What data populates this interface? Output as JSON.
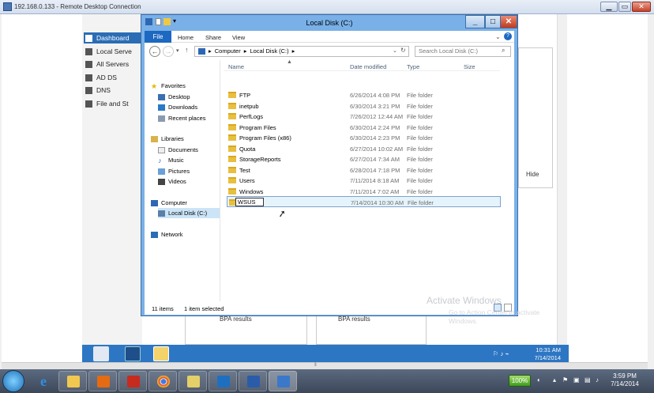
{
  "rdp": {
    "title": "192.168.0.133 - Remote Desktop Connection",
    "minimize": "▁",
    "restore": "▭",
    "close": "✕"
  },
  "server_manager": {
    "nav": [
      "Dashboard",
      "Local Server",
      "All Servers",
      "AD DS",
      "DNS",
      "File and Storage Services"
    ],
    "nav_visible": [
      "Dashboard",
      "Local Serve",
      "All Servers",
      "AD DS",
      "DNS",
      "File and St"
    ],
    "hide_label": "Hide",
    "bpa1": "BPA results",
    "bpa2": "BPA results",
    "clock_time": "10:31 AM",
    "clock_date": "7/14/2014"
  },
  "explorer": {
    "title": "Local Disk (C:)",
    "ribbon_tabs": [
      "File",
      "Home",
      "Share",
      "View"
    ],
    "address": [
      "Computer",
      "Local Disk (C:)"
    ],
    "search_placeholder": "Search Local Disk (C:)",
    "columns": [
      "Name",
      "Date modified",
      "Type",
      "Size"
    ],
    "nav_pane": {
      "favorites": "Favorites",
      "favorites_items": [
        "Desktop",
        "Downloads",
        "Recent places"
      ],
      "libraries": "Libraries",
      "libraries_items": [
        "Documents",
        "Music",
        "Pictures",
        "Videos"
      ],
      "computer": "Computer",
      "computer_items": [
        "Local Disk (C:)"
      ],
      "network": "Network"
    },
    "files": [
      {
        "name": "FTP",
        "date": "6/26/2014 4:08 PM",
        "type": "File folder"
      },
      {
        "name": "inetpub",
        "date": "6/30/2014 3:21 PM",
        "type": "File folder"
      },
      {
        "name": "PerfLogs",
        "date": "7/26/2012 12:44 AM",
        "type": "File folder"
      },
      {
        "name": "Program Files",
        "date": "6/30/2014 2:24 PM",
        "type": "File folder"
      },
      {
        "name": "Program Files (x86)",
        "date": "6/30/2014 2:23 PM",
        "type": "File folder"
      },
      {
        "name": "Quota",
        "date": "6/27/2014 10:02 AM",
        "type": "File folder"
      },
      {
        "name": "StorageReports",
        "date": "6/27/2014 7:34 AM",
        "type": "File folder"
      },
      {
        "name": "Test",
        "date": "6/28/2014 7:18 PM",
        "type": "File folder"
      },
      {
        "name": "Users",
        "date": "7/11/2014 8:18 AM",
        "type": "File folder"
      },
      {
        "name": "Windows",
        "date": "7/11/2014 7:02 AM",
        "type": "File folder"
      },
      {
        "name": "WSUS",
        "date": "7/14/2014 10:30 AM",
        "type": "File folder"
      }
    ],
    "status_count": "11 items",
    "status_selected": "1 item selected"
  },
  "watermark": {
    "line1": "Activate Windows",
    "line2": "Go to Action Center to activate",
    "line3": "Windows."
  },
  "taskbar": {
    "zoom": "100%",
    "time": "3:59 PM",
    "date": "7/14/2014"
  }
}
